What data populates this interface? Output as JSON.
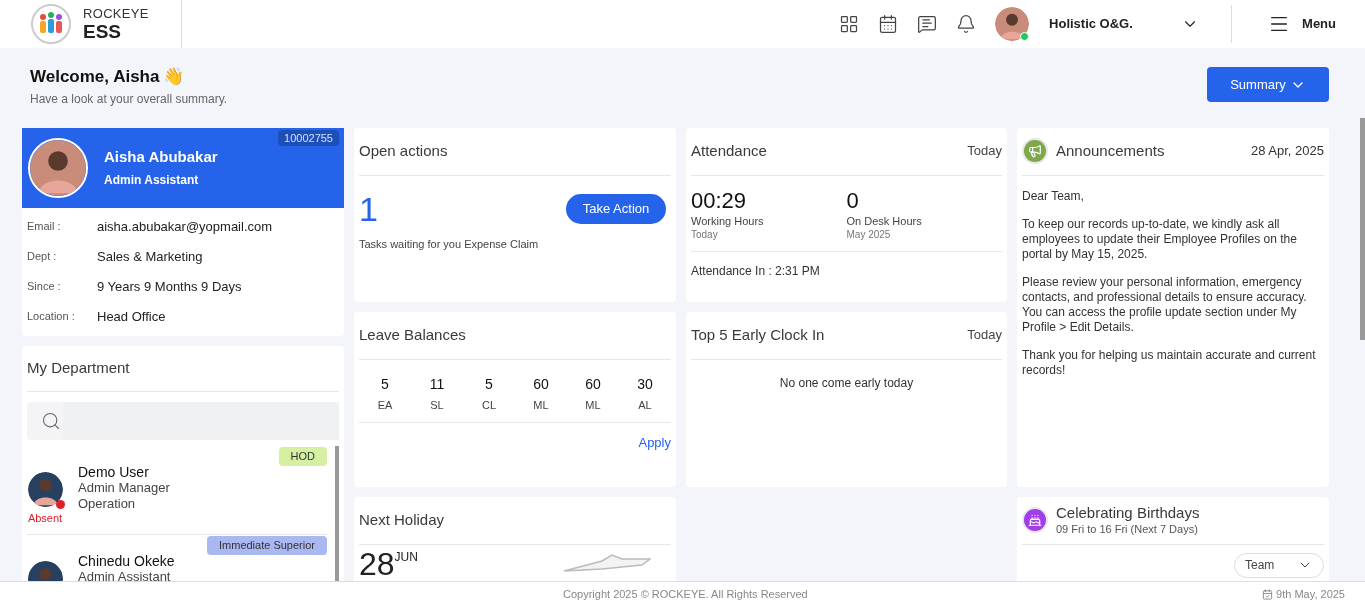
{
  "header": {
    "brand_top": "ROCKEYE",
    "brand_bottom": "ESS",
    "company": "Holistic O&G.",
    "menu_label": "Menu",
    "user_online": true
  },
  "greeting": {
    "title": "Welcome, Aisha",
    "emoji": "👋",
    "subtitle": "Have a look at your overall summary.",
    "button": "Summary"
  },
  "profile": {
    "id": "10002755",
    "name": "Aisha Abubakar",
    "role": "Admin Assistant",
    "fields": [
      {
        "label": "Email :",
        "value": "aisha.abubakar@yopmail.com"
      },
      {
        "label": "Dept :",
        "value": "Sales & Marketing"
      },
      {
        "label": "Since :",
        "value": "9 Years 9 Months 9 Days"
      },
      {
        "label": "Location :",
        "value": "Head Office"
      }
    ]
  },
  "department": {
    "title": "My Department",
    "members": [
      {
        "name": "Demo User",
        "role": "Admin Manager",
        "dept": "Operation",
        "tag": {
          "label": "HOD",
          "color": "#d4f0a0"
        },
        "status": "Absent",
        "color": "#e11d2a"
      },
      {
        "name": "Chinedu Okeke",
        "role": "Admin Assistant",
        "tag": {
          "label": "Immediate Superior",
          "color": "#a9b8f0"
        }
      }
    ]
  },
  "open_actions": {
    "title": "Open actions",
    "count": "1",
    "button": "Take Action",
    "description": "Tasks waiting for you Expense Claim"
  },
  "leave_balances": {
    "title": "Leave Balances",
    "items": [
      {
        "value": "5",
        "code": "EA"
      },
      {
        "value": "11",
        "code": "SL"
      },
      {
        "value": "5",
        "code": "CL"
      },
      {
        "value": "60",
        "code": "ML"
      },
      {
        "value": "60",
        "code": "ML"
      },
      {
        "value": "30",
        "code": "AL"
      }
    ],
    "link": "Apply"
  },
  "next_holiday": {
    "title": "Next Holiday",
    "day": "28",
    "month": "JUN"
  },
  "attendance": {
    "title": "Attendance",
    "period": "Today",
    "stats": [
      {
        "value": "00:29",
        "label": "Working Hours",
        "sub": "Today"
      },
      {
        "value": "0",
        "label": "On Desk Hours",
        "sub": "May 2025"
      }
    ],
    "footer": "Attendance In : 2:31 PM"
  },
  "early_clock_in": {
    "title": "Top 5 Early Clock In",
    "period": "Today",
    "empty": "No one come early today"
  },
  "announcements": {
    "title": "Announcements",
    "date": "28 Apr, 2025",
    "paragraphs": [
      "Dear Team,",
      "To keep our records up-to-date, we kindly ask all employees to update their Employee Profiles on the portal by May 15, 2025.",
      "Please review your personal information, emergency contacts, and professional details to ensure accuracy. You can access the profile update section under My Profile > Edit Details.",
      "Thank you for helping us maintain accurate and current records!"
    ]
  },
  "birthdays": {
    "title": "Celebrating Birthdays",
    "subtitle": "09 Fri to 16 Fri (Next 7 Days)",
    "filter": "Team"
  },
  "footer": {
    "copyright": "Copyright 2025 © ROCKEYE. All Rights Reserved",
    "date": "9th May, 2025"
  }
}
